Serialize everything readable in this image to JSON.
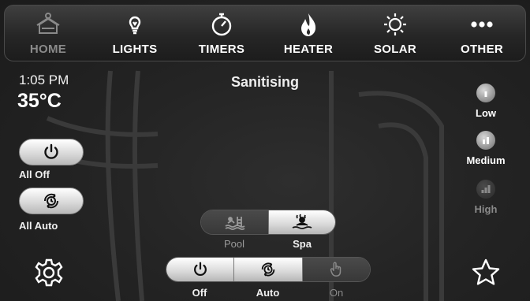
{
  "nav": [
    {
      "label": "HOME",
      "icon": "pool-home-icon",
      "active": true
    },
    {
      "label": "LIGHTS",
      "icon": "lightbulb-icon",
      "active": false
    },
    {
      "label": "TIMERS",
      "icon": "stopwatch-icon",
      "active": false
    },
    {
      "label": "HEATER",
      "icon": "flame-icon",
      "active": false
    },
    {
      "label": "SOLAR",
      "icon": "sun-icon",
      "active": false
    },
    {
      "label": "OTHER",
      "icon": "more-dots-icon",
      "active": false
    }
  ],
  "clock": {
    "time": "1:05 PM",
    "temperature": "35°C"
  },
  "status": "Sanitising",
  "left_controls": {
    "all_off": "All Off",
    "all_auto": "All Auto"
  },
  "speed": {
    "low": "Low",
    "medium": "Medium",
    "high": "High",
    "selected": "Medium"
  },
  "pool_spa": {
    "pool": "Pool",
    "spa": "Spa",
    "selected": "Spa"
  },
  "mode": {
    "off": "Off",
    "auto": "Auto",
    "on": "On",
    "selected": "Auto"
  },
  "colors": {
    "accent_text": "#ffffff",
    "dim_text": "#8a8a8a",
    "button_light": "#d6d6d6"
  }
}
